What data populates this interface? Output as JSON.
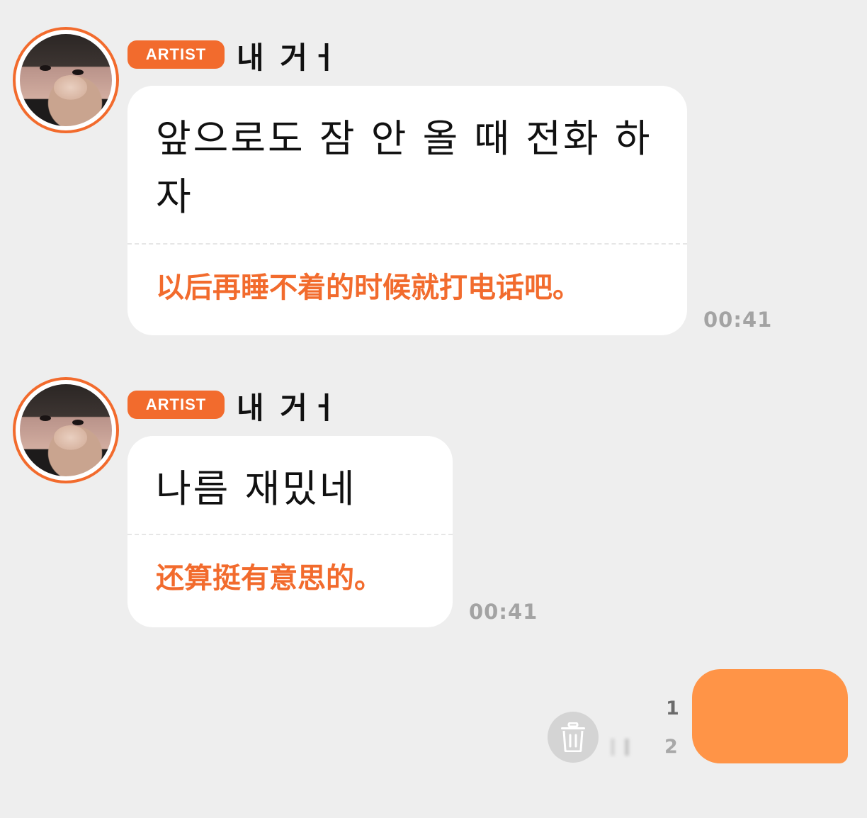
{
  "messages": [
    {
      "badge": "ARTIST",
      "sender": "내 거ㅓ",
      "original": "앞으로도 잠 안 올 때 전화 하자",
      "translation": "以后再睡不着的时候就打电话吧。",
      "time": "00:41"
    },
    {
      "badge": "ARTIST",
      "sender": "내 거ㅓ",
      "original": "나름 재밌네",
      "translation": "还算挺有意思的。",
      "time": "00:41"
    }
  ],
  "my_message": {
    "read_count": "1",
    "send_count": "2",
    "delete_icon": "trash-icon",
    "bubble_color": "#ff9447"
  },
  "colors": {
    "accent": "#f26b2d",
    "background": "#eeeeee",
    "time": "#a3a3a3"
  }
}
